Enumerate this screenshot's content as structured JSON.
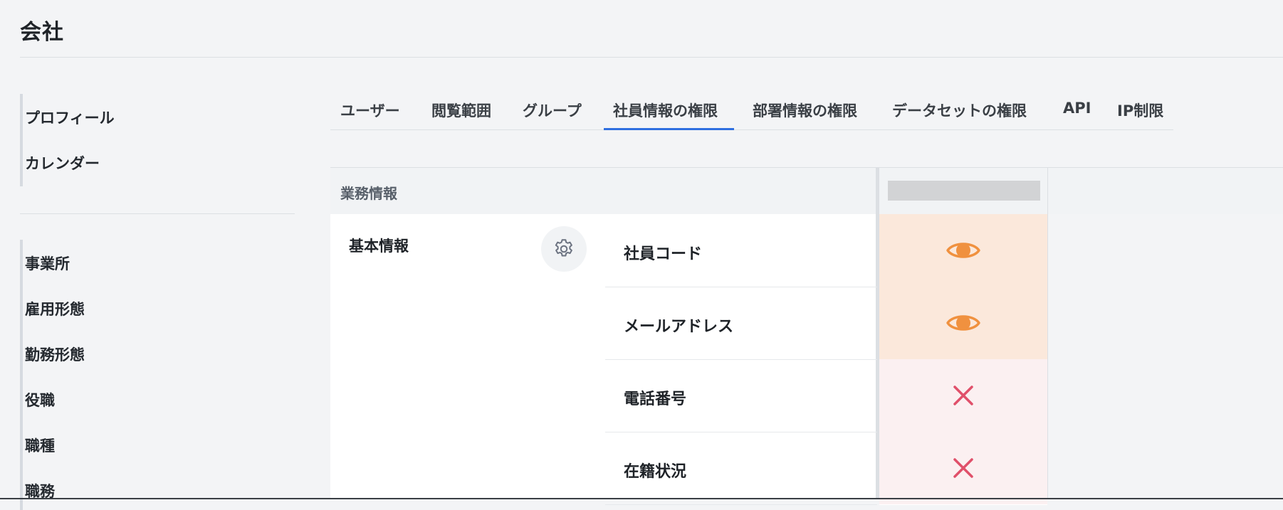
{
  "page": {
    "title": "会社"
  },
  "sidebar": {
    "group1": [
      {
        "label": "プロフィール"
      },
      {
        "label": "カレンダー"
      }
    ],
    "group2": [
      {
        "label": "事業所"
      },
      {
        "label": "雇用形態"
      },
      {
        "label": "勤務形態"
      },
      {
        "label": "役職"
      },
      {
        "label": "職種"
      },
      {
        "label": "職務"
      }
    ]
  },
  "tabs": [
    {
      "label": "ユーザー"
    },
    {
      "label": "閲覧範囲"
    },
    {
      "label": "グループ"
    },
    {
      "label": "社員情報の権限",
      "active": true
    },
    {
      "label": "部署情報の権限"
    },
    {
      "label": "データセットの権限"
    },
    {
      "label": "API"
    },
    {
      "label": "IP制限"
    }
  ],
  "table": {
    "section_label": "業務情報",
    "category": "基本情報",
    "rows": [
      {
        "label": "社員コード",
        "permission": "view"
      },
      {
        "label": "メールアドレス",
        "permission": "view"
      },
      {
        "label": "電話番号",
        "permission": "none"
      },
      {
        "label": "在籍状況",
        "permission": "none"
      }
    ]
  },
  "colors": {
    "accent": "#2f6fe0",
    "view_icon": "#f0913f",
    "view_bg": "#fbe8db",
    "none_icon": "#e0506a",
    "none_bg": "#fbf0f1"
  },
  "icons": {
    "settings": "gear-icon",
    "view": "eye-icon",
    "none": "close-icon"
  }
}
